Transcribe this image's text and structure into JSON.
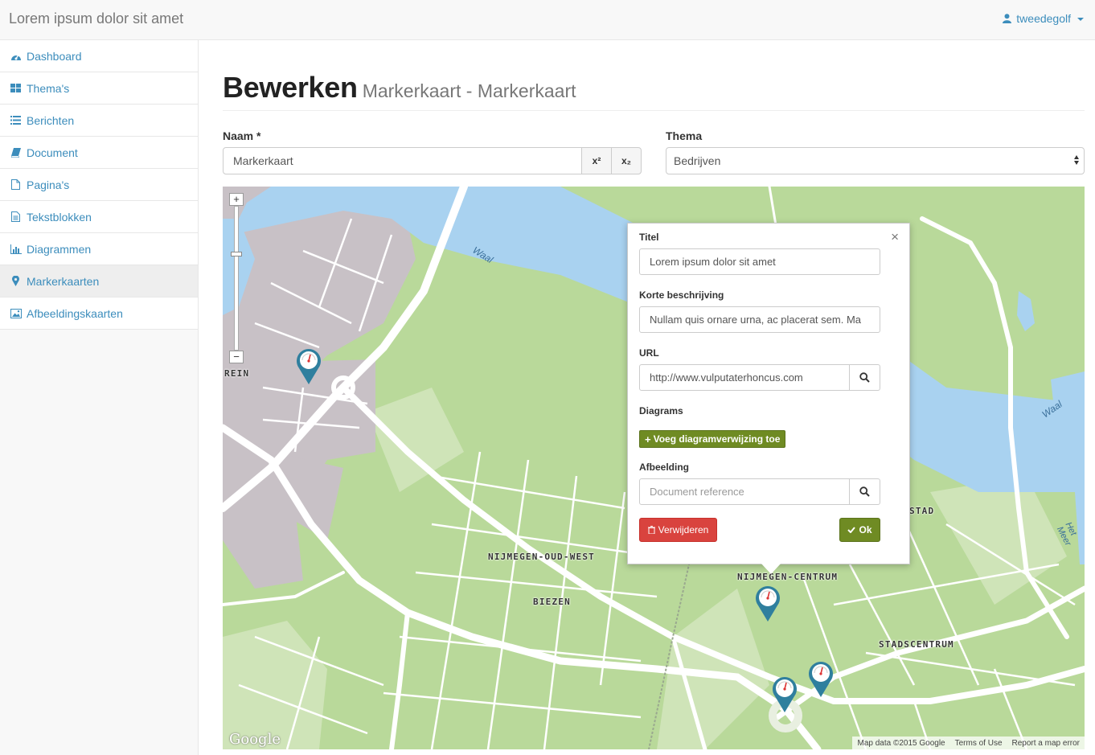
{
  "navbar": {
    "brand": "Lorem ipsum dolor sit amet",
    "username": "tweedegolf",
    "user_icon": "user-icon"
  },
  "sidebar": {
    "items": [
      {
        "label": "Dashboard",
        "icon": "dashboard-icon",
        "active": false
      },
      {
        "label": "Thema's",
        "icon": "grid-icon",
        "active": false
      },
      {
        "label": "Berichten",
        "icon": "list-icon",
        "active": false
      },
      {
        "label": "Document",
        "icon": "book-icon",
        "active": false
      },
      {
        "label": "Pagina's",
        "icon": "file-icon",
        "active": false
      },
      {
        "label": "Tekstblokken",
        "icon": "file-text-icon",
        "active": false
      },
      {
        "label": "Diagrammen",
        "icon": "bar-chart-icon",
        "active": false
      },
      {
        "label": "Markerkaarten",
        "icon": "map-marker-icon",
        "active": true
      },
      {
        "label": "Afbeeldingskaarten",
        "icon": "image-icon",
        "active": false
      }
    ]
  },
  "header": {
    "title": "Bewerken",
    "subtitle": "Markerkaart - Markerkaart"
  },
  "form": {
    "naam_label": "Naam *",
    "naam_value": "Markerkaart",
    "superscript_label": "x²",
    "subscript_label": "x₂",
    "thema_label": "Thema",
    "thema_value": "Bedrijven"
  },
  "map": {
    "labels": {
      "rein": "REIN",
      "oud_west": "NIJMEGEN-OUD-WEST",
      "biezen": "BIEZEN",
      "centrum": "NIJMEGEN-CENTRUM",
      "stadscentrum": "STADSCENTRUM",
      "stad": "STAD"
    },
    "water_labels": {
      "waal_1": "Waal",
      "waal_2": "Waal",
      "meer": "Het Meer"
    },
    "google_logo": "Google",
    "attribution": {
      "map_data": "Map data ©2015 Google",
      "terms": "Terms of Use",
      "report": "Report a map error"
    },
    "zoom_in": "+",
    "zoom_out": "−"
  },
  "popup": {
    "titel_label": "Titel",
    "titel_value": "Lorem ipsum dolor sit amet",
    "beschrijving_label": "Korte beschrijving",
    "beschrijving_value": "Nullam quis ornare urna, ac placerat sem. Ma",
    "url_label": "URL",
    "url_value": "http://www.vulputaterhoncus.com",
    "diagrams_label": "Diagrams",
    "add_diagram_label": "Voeg diagramverwijzing toe",
    "afbeelding_label": "Afbeelding",
    "afbeelding_placeholder": "Document reference",
    "delete_label": "Verwijderen",
    "ok_label": "Ok",
    "close": "×"
  },
  "colors": {
    "link": "#3c8dbc",
    "btn_success": "#6f8b23",
    "btn_danger": "#d9433e",
    "marker": "#2f7f9e",
    "map_green": "#b9d99a",
    "map_water": "#a9d2f0",
    "map_urban": "#c8c1c6"
  }
}
